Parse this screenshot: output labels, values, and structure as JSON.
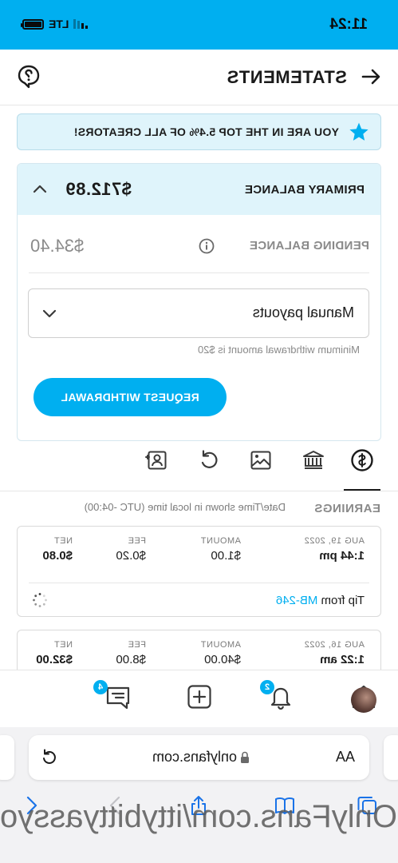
{
  "status": {
    "time": "11:24",
    "network": "LTE"
  },
  "header": {
    "title": "STATEMENTS"
  },
  "banner": {
    "text": "YOU ARE IN THE TOP 5.4% OF ALL CREATORS!"
  },
  "balance": {
    "primary_label": "PRIMARY BALANCE",
    "primary_amount": "$712.89",
    "pending_label": "PENDING BALANCE",
    "pending_amount": "$34.40",
    "payout_select": "Manual payouts",
    "min_hint": "Minimum withdrawal amount is $20",
    "request_button": "REQUEST WITHDRAWAL"
  },
  "icon_tabs": [
    "dollar-circle-icon",
    "bank-icon",
    "image-icon",
    "redo-icon",
    "user-card-icon"
  ],
  "earnings": {
    "title": "EARNINGS",
    "timezone_note": "Date/Time shown in local time (UTC -04:00)",
    "columns": [
      "AMOUNT",
      "FEE",
      "NET"
    ],
    "rows": [
      {
        "date": "AUG 19, 2022",
        "time": "1:44 pm",
        "amount": "$1.00",
        "fee": "$0.20",
        "net": "$0.80",
        "desc_prefix": "Tip from",
        "desc_link": "MB-246"
      },
      {
        "date": "AUG 16, 2022",
        "time": "1:22 am",
        "amount": "$40.00",
        "fee": "$8.00",
        "net": "$32.00"
      }
    ]
  },
  "tabbar": {
    "messages_badge": "4",
    "notifications_badge": "2"
  },
  "browser": {
    "aa": "AA",
    "url": "onlyfans.com",
    "watermark": "OnlyFans.com/ittybittyassyo"
  },
  "colors": {
    "accent": "#00aff0",
    "banner_bg": "#dff4fb"
  }
}
